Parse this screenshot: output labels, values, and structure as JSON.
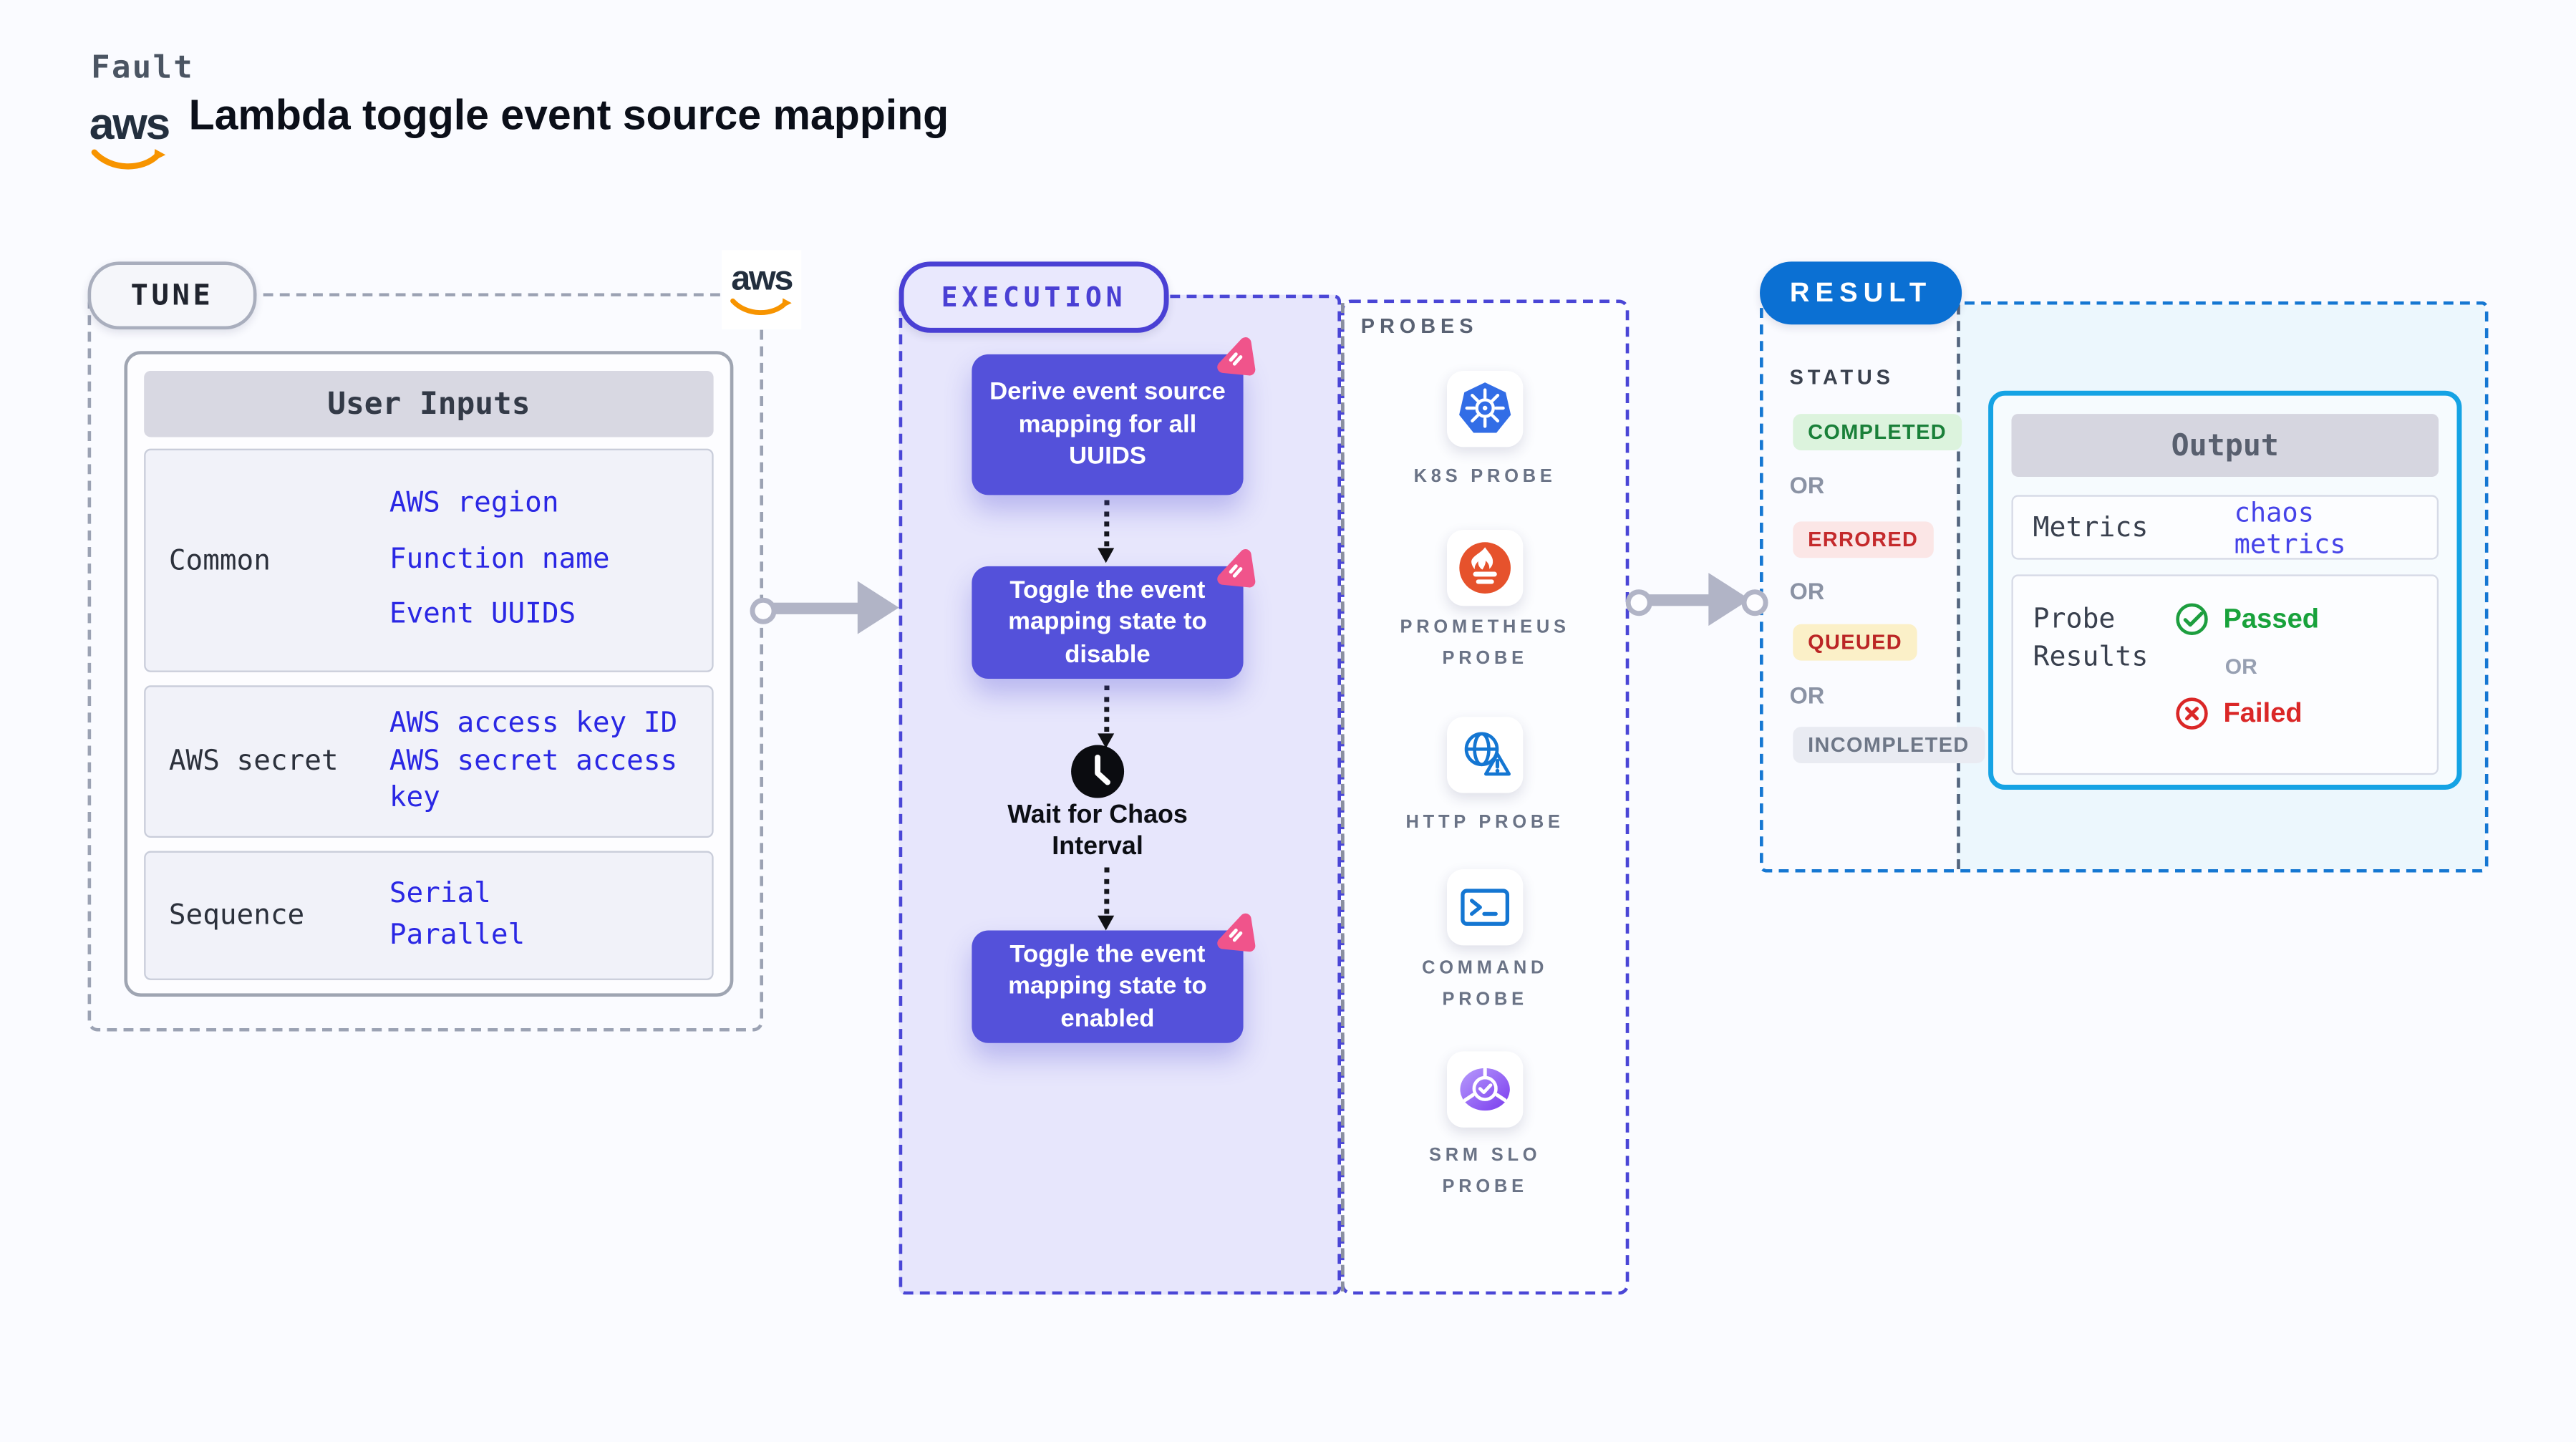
{
  "header": {
    "product_label": "Fault",
    "title": "Lambda toggle event source mapping",
    "aws_logo_text": "aws"
  },
  "tune": {
    "pill_label": "TUNE",
    "table": {
      "title": "User Inputs",
      "rows": [
        {
          "label": "Common",
          "values": [
            "AWS region",
            "Function name",
            "Event UUIDS"
          ]
        },
        {
          "label": "AWS secret",
          "values": [
            "AWS access key ID",
            "AWS secret access key"
          ]
        },
        {
          "label": "Sequence",
          "values": [
            "Serial",
            "Parallel"
          ]
        }
      ]
    }
  },
  "execution": {
    "pill_label": "EXECUTION",
    "steps": [
      {
        "label": "Derive event source mapping for all UUIDS",
        "icon": "chaos-pink-badge-icon"
      },
      {
        "label": "Toggle the event mapping state to disable",
        "icon": "chaos-pink-badge-icon"
      },
      {
        "label": "Toggle the event mapping state to enabled",
        "icon": "chaos-pink-badge-icon"
      }
    ],
    "wait_step_label": "Wait for Chaos Interval",
    "wait_step_icon": "clock-icon"
  },
  "probes": {
    "title": "PROBES",
    "items": [
      {
        "label": "K8S PROBE",
        "icon": "kubernetes-icon"
      },
      {
        "label": "PROMETHEUS PROBE",
        "icon": "prometheus-icon"
      },
      {
        "label": "HTTP PROBE",
        "icon": "http-globe-warning-icon"
      },
      {
        "label": "COMMAND PROBE",
        "icon": "terminal-icon"
      },
      {
        "label": "SRM SLO PROBE",
        "icon": "srm-slo-pie-check-icon"
      }
    ]
  },
  "result": {
    "pill_label": "RESULT",
    "status_heading": "STATUS",
    "or_label": "OR",
    "statuses": [
      {
        "label": "COMPLETED",
        "fg": "#1a8039",
        "bg": "#dcf3dd"
      },
      {
        "label": "ERRORED",
        "fg": "#c42a2c",
        "bg": "#fbe6e6"
      },
      {
        "label": "QUEUED",
        "fg": "#bb2525",
        "bg": "#fbf0c8"
      },
      {
        "label": "INCOMPLETED",
        "fg": "#6e7787",
        "bg": "#e9ebf2"
      }
    ],
    "output": {
      "title": "Output",
      "metrics_label": "Metrics",
      "metrics_value": "chaos metrics",
      "probe_results_label": "Probe Results",
      "passed_label": "Passed",
      "passed_icon": "check-circle-icon",
      "failed_label": "Failed",
      "failed_icon": "x-circle-icon"
    }
  },
  "colors": {
    "page_background": "#fafbff",
    "accent_indigo": "#4a40d4",
    "step_purple": "#5451da",
    "chaos_pink": "#f0548b",
    "link_blue": "#2a27e4",
    "result_blue": "#0b70d3",
    "output_border_cyan": "#15a3e4",
    "passed_green": "#18a23b",
    "failed_red": "#da2727",
    "kubernetes_blue": "#326de6",
    "prometheus_orange": "#e6522c",
    "srm_purple": "#7a3bee",
    "aws_orange": "#f79400"
  }
}
